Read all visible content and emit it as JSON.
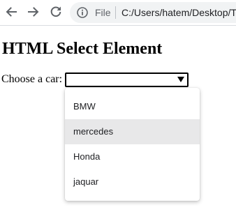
{
  "browser": {
    "scheme_label": "File",
    "url": "C:/Users/hatem/Desktop/T"
  },
  "page": {
    "heading": "HTML Select Element",
    "select_label": "Choose a car:",
    "select_value": "",
    "options": [
      {
        "label": "BMW",
        "highlighted": false
      },
      {
        "label": "mercedes",
        "highlighted": true
      },
      {
        "label": "Honda",
        "highlighted": false
      },
      {
        "label": "jaquar",
        "highlighted": false
      }
    ]
  },
  "icons": {
    "back": "back-arrow-icon",
    "forward": "forward-arrow-icon",
    "reload": "reload-icon",
    "site_info": "info-icon",
    "dropdown": "dropdown-triangle-icon"
  },
  "colors": {
    "toolbar_icon": "#5f6368",
    "omnibox_bg": "#f1f3f4",
    "option_highlight": "#e8e8e9",
    "text": "#000000"
  }
}
